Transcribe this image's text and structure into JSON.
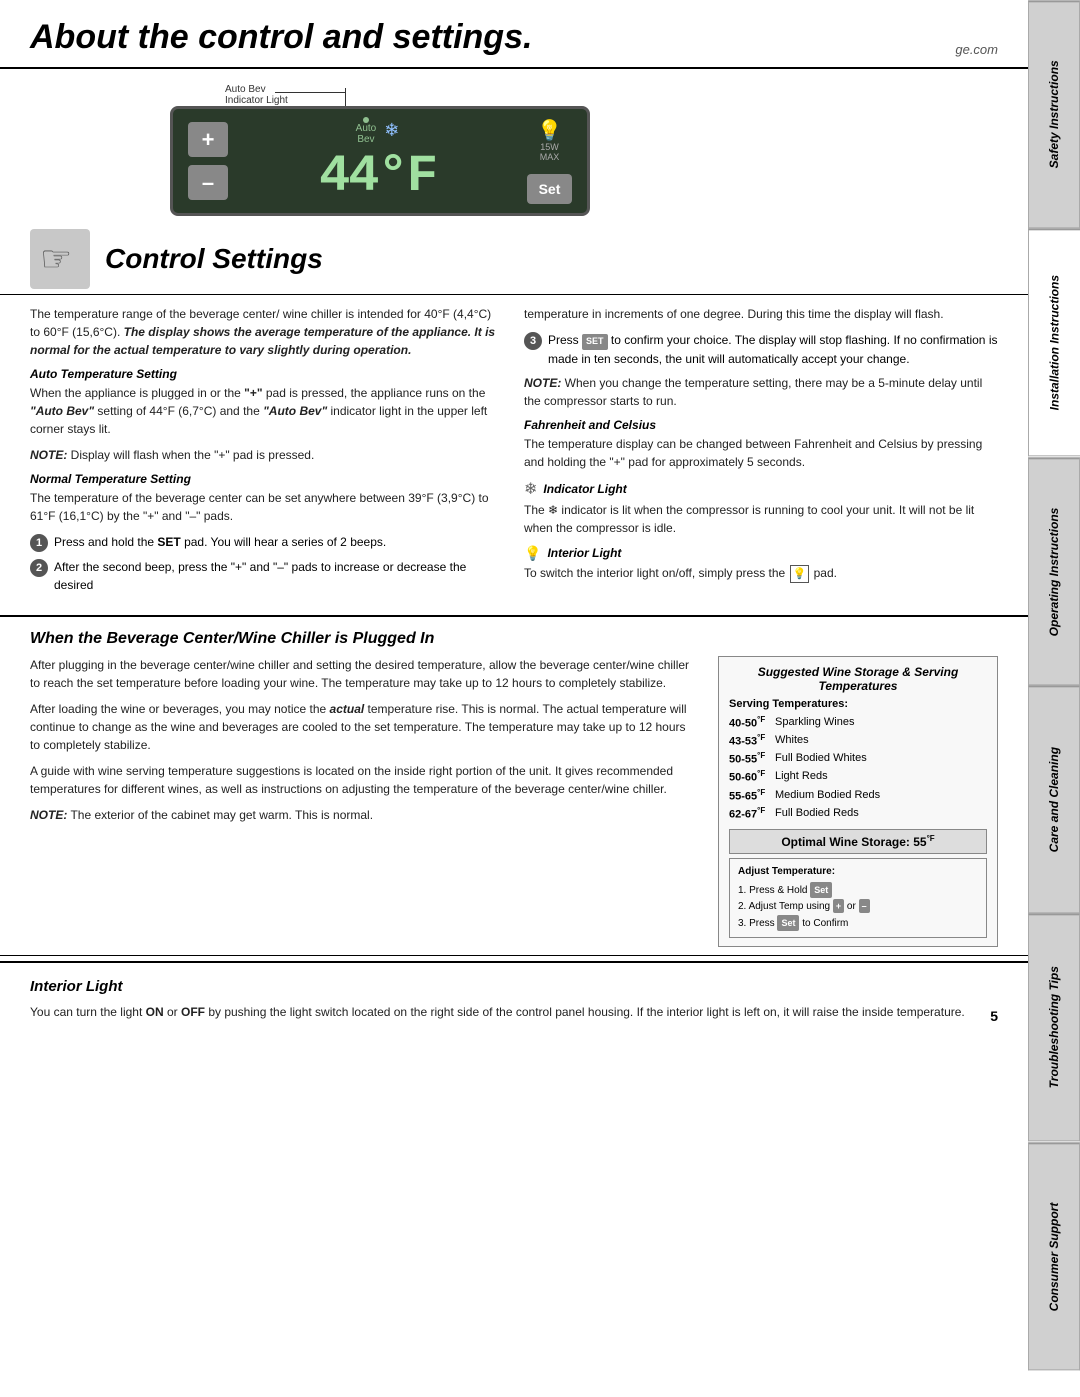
{
  "page": {
    "title": "About the control and settings.",
    "website": "ge.com",
    "page_number": "5"
  },
  "sidebar": {
    "tabs": [
      {
        "id": "safety",
        "label": "Safety Instructions"
      },
      {
        "id": "installation",
        "label": "Installation Instructions"
      },
      {
        "id": "operating",
        "label": "Operating Instructions"
      },
      {
        "id": "care",
        "label": "Care and Cleaning"
      },
      {
        "id": "troubleshooting",
        "label": "Troubleshooting Tips"
      },
      {
        "id": "consumer",
        "label": "Consumer Support"
      }
    ]
  },
  "display": {
    "auto_bev_label": "Auto Bev",
    "indicator_light_label": "Indicator Light",
    "temp": "44°F",
    "plus_btn": "+",
    "minus_btn": "–",
    "set_btn": "Set",
    "light_label": "15W\nMAX"
  },
  "control_settings": {
    "title": "Control Settings",
    "intro": "The temperature range of the beverage center/ wine chiller is intended for 40°F (4,4°C) to 60°F (15,6°C). The display shows the average temperature of the appliance. It is normal for the actual temperature to vary slightly during operation.",
    "right_intro": "temperature in increments of one degree. During this time the display will flash.",
    "step3": "Press SET to confirm your choice. The display will stop flashing. If no confirmation is made in ten seconds, the unit will automatically accept your change.",
    "note_delay": "NOTE: When you change the temperature setting, there may be a 5-minute delay until the compressor starts to run.",
    "auto_temp_heading": "Auto Temperature Setting",
    "auto_temp_text": "When the appliance is plugged in or the \"+\" pad is pressed, the appliance runs on the \"Auto Bev\" setting of 44°F (6,7°C) and the \"Auto Bev\" indicator light in the upper left corner stays lit.",
    "auto_temp_note": "NOTE: Display will flash when the \"+\" pad is pressed.",
    "normal_temp_heading": "Normal Temperature Setting",
    "normal_temp_text": "The temperature of the beverage center can be set anywhere between 39°F (3,9°C) to 61°F (16,1°C) by the \"+\" and \"–\" pads.",
    "step1": "Press and hold the SET pad. You will hear a series of 2 beeps.",
    "step2": "After the second beep, press the \"+\" and \"–\" pads to increase or decrease the desired",
    "fahrenheit_heading": "Fahrenheit and Celsius",
    "fahrenheit_text": "The temperature display can be changed between Fahrenheit and Celsius by pressing and holding the \"+\" pad for approximately 5 seconds.",
    "indicator_heading": "Indicator Light",
    "indicator_text": "The ❄ indicator is lit when the compressor is running to cool your unit. It will not be lit when the compressor is idle.",
    "interior_light_heading": "Interior Light",
    "interior_light_text": "To switch the interior light on/off, simply press the 🔆 pad."
  },
  "when_plugged": {
    "title": "When the Beverage Center/Wine Chiller is Plugged In",
    "left_text1": "After plugging in the beverage center/wine chiller and setting the desired temperature, allow the beverage center/wine chiller to reach the set temperature before loading your wine. The temperature may take up to 12 hours to completely stabilize.",
    "left_text2": "After loading the wine or beverages, you may notice the actual temperature rise. This is normal. The actual temperature will continue to change as the wine and beverages are cooled to the set temperature. The temperature may take up to 12 hours to completely stabilize.",
    "left_text3": "A guide with wine serving temperature suggestions is located on the inside right portion of the unit. It gives recommended temperatures for different wines, as well as instructions on adjusting the temperature of the beverage center/wine chiller.",
    "left_note": "NOTE: The exterior of the cabinet may get warm. This is normal.",
    "wine_storage_title": "Suggested Wine Storage & Serving Temperatures",
    "serving_header": "Serving Temperatures:",
    "wine_rows": [
      {
        "temp": "40-50°F",
        "name": "Sparkling Wines"
      },
      {
        "temp": "43-53°F",
        "name": "Whites"
      },
      {
        "temp": "50-55°F",
        "name": "Full Bodied Whites"
      },
      {
        "temp": "50-60°F",
        "name": "Light Reds"
      },
      {
        "temp": "55-65°F",
        "name": "Medium Bodied Reds"
      },
      {
        "temp": "62-67°F",
        "name": "Full Bodied Reds"
      }
    ],
    "optimal_label": "Optimal Wine Storage:",
    "optimal_temp": "55°F",
    "adjust_title": "Adjust Temperature:",
    "adjust_steps": [
      "1. Press & Hold Set",
      "2. Adjust Temp using + or –",
      "3. Press Set to Confirm"
    ]
  },
  "interior_light_bottom": {
    "title": "Interior Light",
    "text": "You can turn the light ON or OFF by pushing the light switch located on the right side of the control panel housing. If the interior light is left on, it will raise the inside temperature."
  }
}
